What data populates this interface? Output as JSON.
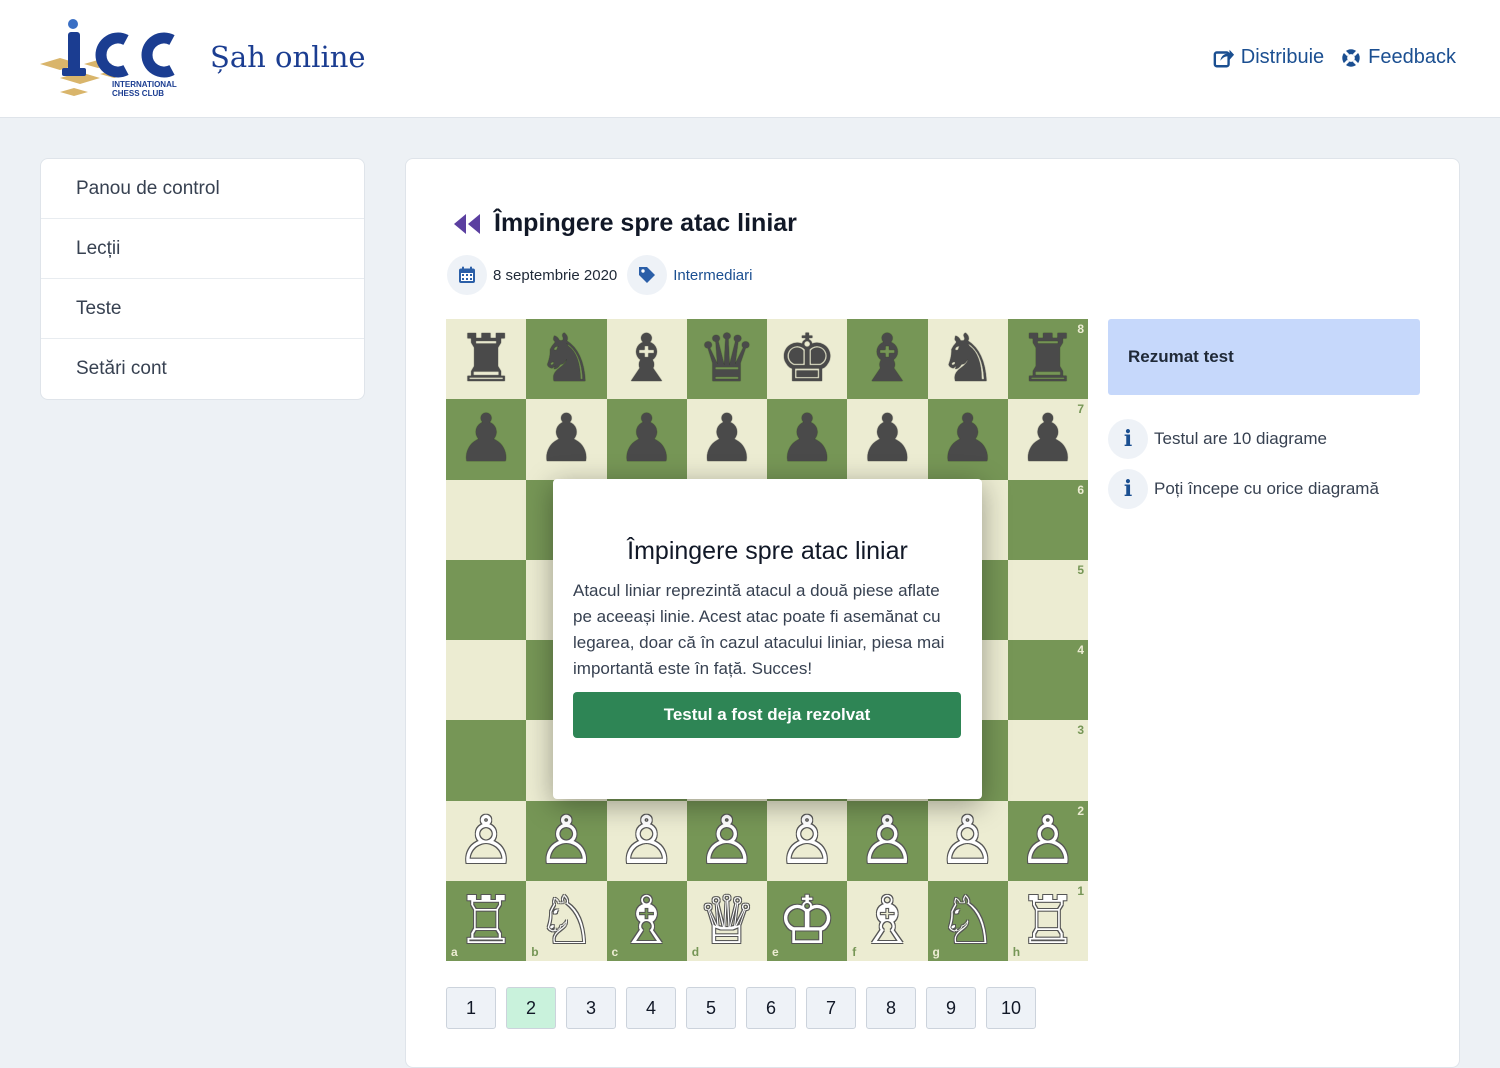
{
  "header": {
    "logo_text": "ICC",
    "logo_subtext": "INTERNATIONAL CHESS CLUB",
    "site_title": "Șah online",
    "share_label": "Distribuie",
    "feedback_label": "Feedback"
  },
  "sidebar": {
    "items": [
      {
        "label": "Panou de control"
      },
      {
        "label": "Lecții"
      },
      {
        "label": "Teste"
      },
      {
        "label": "Setări cont"
      }
    ]
  },
  "main": {
    "title": "Împingere spre atac liniar",
    "date": "8 septembrie 2020",
    "tag": "Intermediari"
  },
  "board": {
    "rows": [
      [
        "♜",
        "♞",
        "♝",
        "♛",
        "♚",
        "♝",
        "♞",
        "♜"
      ],
      [
        "♟",
        "♟",
        "♟",
        "♟",
        "♟",
        "♟",
        "♟",
        "♟"
      ],
      [
        "",
        "",
        "",
        "",
        "",
        "",
        "",
        ""
      ],
      [
        "",
        "",
        "",
        "",
        "",
        "",
        "",
        ""
      ],
      [
        "",
        "",
        "",
        "",
        "",
        "",
        "",
        ""
      ],
      [
        "",
        "",
        "",
        "",
        "",
        "",
        "",
        ""
      ],
      [
        "♙",
        "♙",
        "♙",
        "♙",
        "♙",
        "♙",
        "♙",
        "♙"
      ],
      [
        "♖",
        "♘",
        "♗",
        "♕",
        "♔",
        "♗",
        "♘",
        "♖"
      ]
    ],
    "ranks": [
      "8",
      "7",
      "6",
      "5",
      "4",
      "3",
      "2",
      "1"
    ],
    "files": [
      "a",
      "b",
      "c",
      "d",
      "e",
      "f",
      "g",
      "h"
    ],
    "colors": {
      "light": "#ececd2",
      "dark": "#769656"
    }
  },
  "modal": {
    "title": "Împingere spre atac liniar",
    "text": "Atacul liniar reprezintă atacul a două piese aflate pe aceeași linie. Acest atac poate fi asemănat cu legarea, doar că în cazul atacului liniar, piesa mai importantă este în față. Succes!",
    "button_label": "Testul a fost deja rezolvat",
    "button_color": "#2e8555"
  },
  "summary": {
    "heading": "Rezumat test",
    "items": [
      {
        "text": "Testul are 10 diagrame",
        "icon": "i"
      },
      {
        "text": "Poți începe cu orice diagramă",
        "icon": "i"
      }
    ]
  },
  "pagination": {
    "pages": [
      "1",
      "2",
      "3",
      "4",
      "5",
      "6",
      "7",
      "8",
      "9",
      "10"
    ],
    "active": "2"
  },
  "colors": {
    "brand_blue": "#1b3d91",
    "link_blue": "#1b4f91",
    "accent_purple": "#5b3fa0",
    "summary_bg": "#c6d8fb",
    "active_page_bg": "#c9f2dc"
  }
}
